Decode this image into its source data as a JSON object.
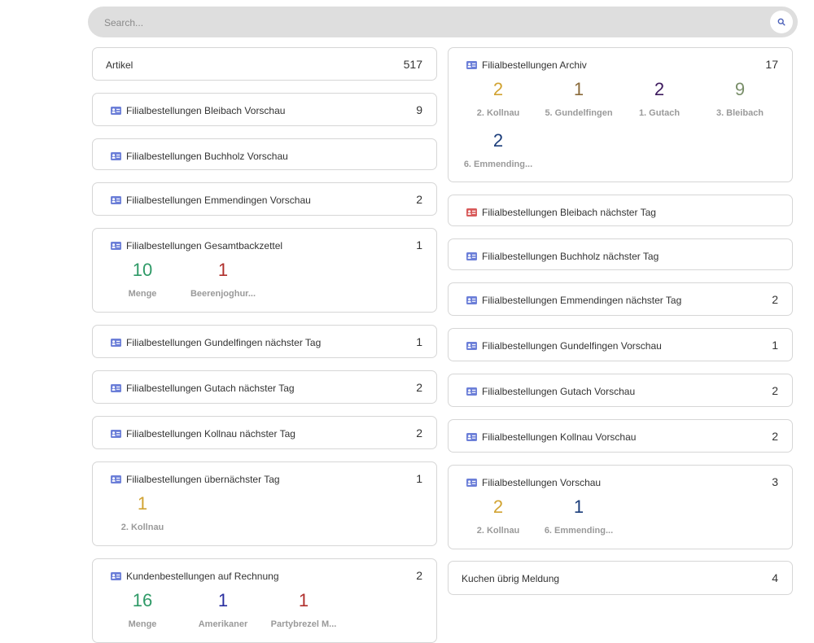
{
  "search": {
    "placeholder": "Search..."
  },
  "icons": {
    "search": "search-icon",
    "card": "contact-card-icon"
  },
  "colors": {
    "green": "#2f9a67",
    "red": "#b0302d",
    "gold": "#d1a332",
    "brown": "#8a6a3a",
    "purple": "#3d1a5e",
    "olive": "#7a8f6a",
    "navy": "#1b3d7a",
    "indigo": "#2a2fa0",
    "icon_blue": "#6c7fd8",
    "icon_red": "#d85a5a"
  },
  "left": [
    {
      "title": "Artikel",
      "count": "517",
      "icon": ""
    },
    {
      "title": "Filialbestellungen Bleibach Vorschau",
      "count": "9",
      "icon": "blue"
    },
    {
      "title": "Filialbestellungen Buchholz Vorschau",
      "count": "",
      "icon": "blue"
    },
    {
      "title": "Filialbestellungen Emmendingen Vorschau",
      "count": "2",
      "icon": "blue"
    },
    {
      "title": "Filialbestellungen Gesamtbackzettel",
      "count": "1",
      "icon": "blue",
      "metrics": [
        {
          "value": "10",
          "label": "Menge",
          "color": "#2f9a67"
        },
        {
          "value": "1",
          "label": "Beerenjoghur...",
          "color": "#b0302d"
        }
      ]
    },
    {
      "title": "Filialbestellungen Gundelfingen nächster Tag",
      "count": "1",
      "icon": "blue"
    },
    {
      "title": "Filialbestellungen Gutach nächster Tag",
      "count": "2",
      "icon": "blue"
    },
    {
      "title": "Filialbestellungen Kollnau nächster Tag",
      "count": "2",
      "icon": "blue"
    },
    {
      "title": "Filialbestellungen übernächster Tag",
      "count": "1",
      "icon": "blue",
      "metrics": [
        {
          "value": "1",
          "label": "2. Kollnau",
          "color": "#d1a332"
        }
      ]
    },
    {
      "title": "Kundenbestellungen auf Rechnung",
      "count": "2",
      "icon": "blue",
      "metrics": [
        {
          "value": "16",
          "label": "Menge",
          "color": "#2f9a67"
        },
        {
          "value": "1",
          "label": "Amerikaner",
          "color": "#2a2fa0"
        },
        {
          "value": "1",
          "label": "Partybrezel M...",
          "color": "#b0302d"
        }
      ]
    }
  ],
  "right": [
    {
      "title": "Filialbestellungen Archiv",
      "count": "17",
      "icon": "blue",
      "metrics": [
        {
          "value": "2",
          "label": "2. Kollnau",
          "color": "#d1a332"
        },
        {
          "value": "1",
          "label": "5. Gundelfingen",
          "color": "#8a6a3a"
        },
        {
          "value": "2",
          "label": "1. Gutach",
          "color": "#3d1a5e"
        },
        {
          "value": "9",
          "label": "3. Bleibach",
          "color": "#7a8f6a"
        },
        {
          "value": "2",
          "label": "6. Emmending...",
          "color": "#1b3d7a"
        }
      ]
    },
    {
      "title": "Filialbestellungen Bleibach nächster Tag",
      "count": "",
      "icon": "red"
    },
    {
      "title": "Filialbestellungen Buchholz nächster Tag",
      "count": "",
      "icon": "blue"
    },
    {
      "title": "Filialbestellungen Emmendingen nächster Tag",
      "count": "2",
      "icon": "blue"
    },
    {
      "title": "Filialbestellungen Gundelfingen Vorschau",
      "count": "1",
      "icon": "blue"
    },
    {
      "title": "Filialbestellungen Gutach Vorschau",
      "count": "2",
      "icon": "blue"
    },
    {
      "title": "Filialbestellungen Kollnau Vorschau",
      "count": "2",
      "icon": "blue"
    },
    {
      "title": "Filialbestellungen Vorschau",
      "count": "3",
      "icon": "blue",
      "metrics": [
        {
          "value": "2",
          "label": "2. Kollnau",
          "color": "#d1a332"
        },
        {
          "value": "1",
          "label": "6. Emmending...",
          "color": "#1b3d7a"
        }
      ]
    },
    {
      "title": "Kuchen übrig Meldung",
      "count": "4",
      "icon": ""
    }
  ]
}
